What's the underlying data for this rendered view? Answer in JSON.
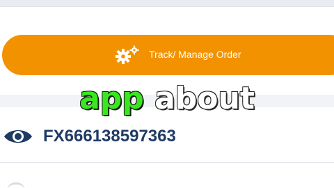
{
  "track_button": {
    "label": "Track/ Manage Order",
    "icon": "gears-icon",
    "color": "#f39200"
  },
  "overlay_caption": {
    "word_1": "app",
    "word_2": "about",
    "word_1_color": "#39e71f",
    "word_2_color": "#ffffff"
  },
  "tracking_entry": {
    "icon": "eye-icon",
    "number": "FX666138597363",
    "color": "#1f3b63"
  }
}
